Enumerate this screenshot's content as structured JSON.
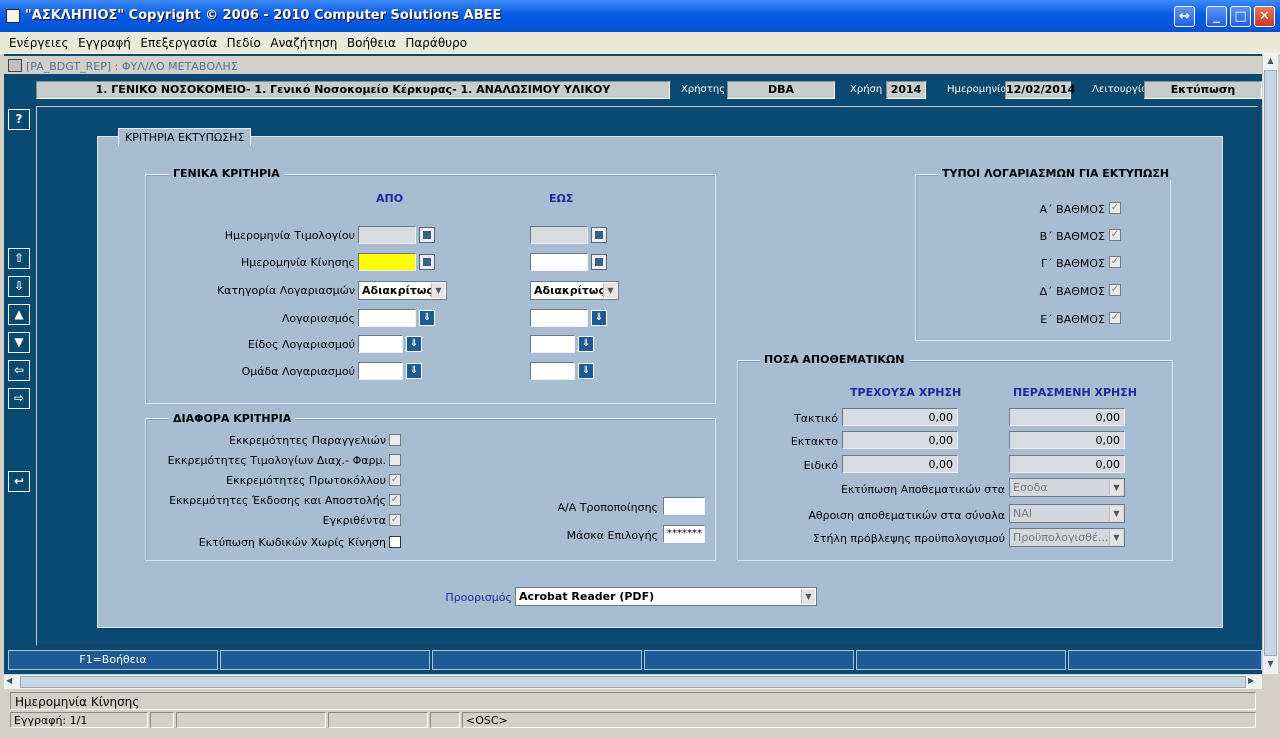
{
  "window": {
    "title": "\"ΑΣΚΛΗΠΙΟΣ\" Copyright © 2006 - 2010 Computer Solutions ΑΒΕΕ"
  },
  "menu": [
    "Ενέργειες",
    "Εγγραφή",
    "Επεξεργασία",
    "Πεδίο",
    "Αναζήτηση",
    "Βοήθεια",
    "Παράθυρο"
  ],
  "form": {
    "id": "[PA_BDGT_REP]",
    "sep": ":",
    "name": "ΦΥΛ/ΛΟ ΜΕΤΑΒΟΛΗΣ"
  },
  "header": {
    "org": "1. ΓΕΝΙΚΟ ΝΟΣΟΚΟΜΕΙΟ- 1. Γενικό Νοσοκομείο Κέρκυρας- 1. ΑΝΑΛΩΣΙΜΟΥ ΥΛΙΚΟΥ",
    "user_label": "Χρήστης",
    "user": "DBA",
    "year_label": "Χρήση",
    "year": "2014",
    "date_label": "Ημερομηνία",
    "date": "12/02/2014",
    "func_label": "Λειτουργία",
    "func": "Εκτύπωση"
  },
  "tab_title": "ΚΡΙΤΗΡΙΑ ΕΚΤΥΠΩΣΗΣ",
  "general": {
    "title": "ΓΕΝΙΚΑ ΚΡΙΤΗΡΙΑ",
    "from": "ΑΠΟ",
    "to": "ΕΩΣ",
    "rows": {
      "invoice_date": "Ημερομηνία Τιμολογίου",
      "move_date": "Ημερομηνία Κίνησης",
      "acc_category": "Κατηγορία Λογαριασμών",
      "account": "Λογαριασμός",
      "acc_type": "Είδος Λογαριασμού",
      "acc_group": "Ομάδα Λογαριασμού"
    },
    "category_from": "Αδιακρίτως",
    "category_to": "Αδιακρίτως"
  },
  "misc": {
    "title": "ΔΙΑΦΟΡΑ ΚΡΙΤΗΡΙΑ",
    "items": [
      "Εκκρεμότητες Παραγγελιών",
      "Εκκρεμότητες Τιμολογίων Διαχ.- Φαρμ.",
      "Εκκρεμότητες Πρωτοκόλλου",
      "Εκκρεμότητες Έκδοσης και Αποστολής",
      "Εγκριθέντα",
      "Εκτύπωση Κωδικών Χωρίς Κίνηση"
    ],
    "revision_label": "Α/Α Τροποποίησης",
    "mask_label": "Μάσκα Επιλογής",
    "mask_value": "*******"
  },
  "account_types": {
    "title": "ΤΥΠΟΙ ΛΟΓΑΡΙΑΣΜΩΝ ΓΙΑ ΕΚΤΥΠΩΣΗ",
    "items": [
      "Α΄ ΒΑΘΜΟΣ",
      "Β΄ ΒΑΘΜΟΣ",
      "Γ΄ ΒΑΘΜΟΣ",
      "Δ΄ ΒΑΘΜΟΣ",
      "Ε΄ ΒΑΘΜΟΣ"
    ]
  },
  "reserves": {
    "title": "ΠΟΣΑ ΑΠΟΘΕΜΑΤΙΚΩΝ",
    "current": "ΤΡΕΧΟΥΣΑ ΧΡΗΣΗ",
    "previous": "ΠΕΡΑΣΜΕΝΗ ΧΡΗΣΗ",
    "rows": [
      {
        "label": "Τακτικό",
        "cur": "0,00",
        "prev": "0,00"
      },
      {
        "label": "Εκτακτο",
        "cur": "0,00",
        "prev": "0,00"
      },
      {
        "label": "Ειδικό",
        "cur": "0,00",
        "prev": "0,00"
      }
    ],
    "print_label": "Εκτύπωση Αποθεματικών στα",
    "print_value": "Εσοδα",
    "sum_label": "Αθροιση αποθεματικών στα σύνολα",
    "sum_value": "ΝΑΙ",
    "col_label": "Στήλη πρόβλεψης προϋπολογισμού",
    "col_value": "Προϋπολογισθέ..."
  },
  "destination": {
    "label": "Προορισμός",
    "value": "Acrobat Reader (PDF)"
  },
  "fkeys": [
    "F1=Βοήθεια",
    "",
    "",
    "",
    "",
    ""
  ],
  "status": {
    "message": "Ημερομηνία Κίνησης",
    "record": "Εγγραφή: 1/1",
    "osc": "<OSC>"
  }
}
